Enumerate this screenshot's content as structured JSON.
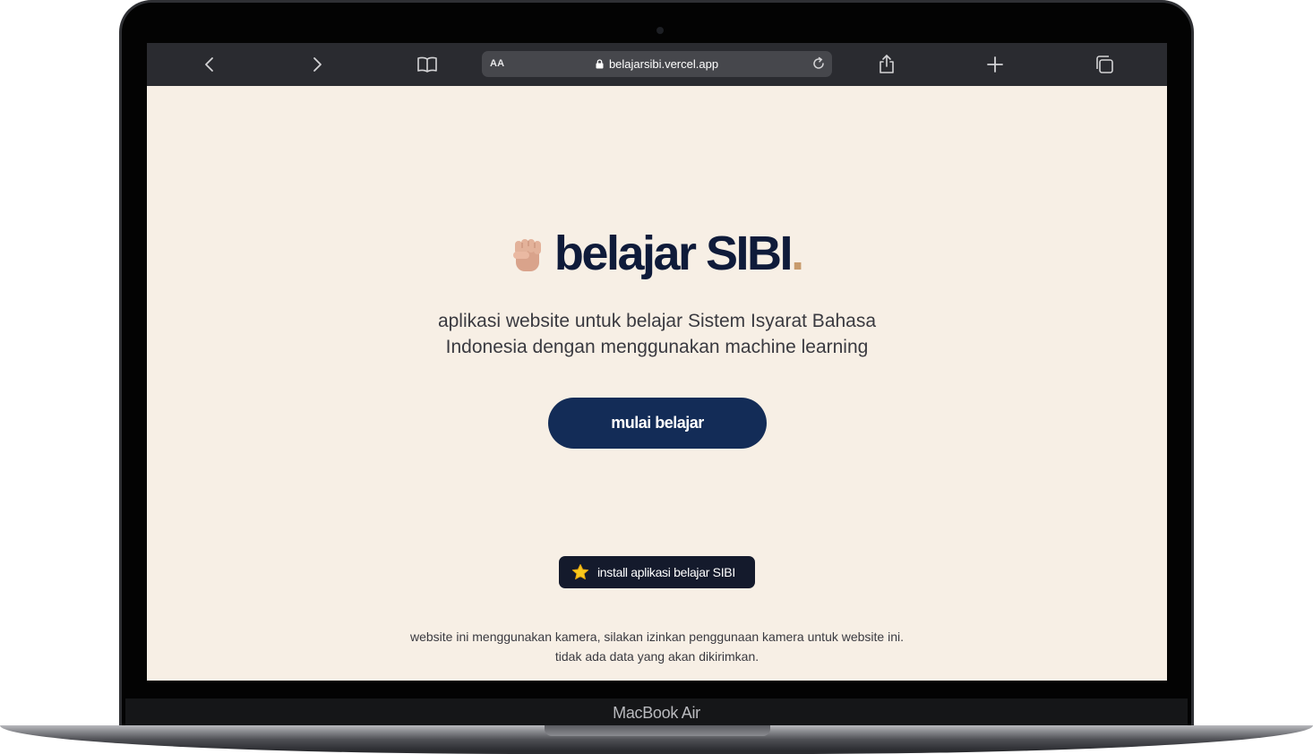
{
  "device": {
    "label": "MacBook Air"
  },
  "browser": {
    "text_size_label": "AA",
    "url": "belajarsibi.vercel.app",
    "icons": [
      "back-icon",
      "forward-icon",
      "bookmarks-icon",
      "lock-icon",
      "reload-icon",
      "share-icon",
      "new-tab-icon",
      "tabs-icon"
    ]
  },
  "page": {
    "brand_icon": "raised-fist-icon",
    "brand_title": "belajar SIBI",
    "brand_dot": ".",
    "tagline": "aplikasi website untuk belajar Sistem Isyarat Bahasa Indonesia dengan menggunakan machine learning",
    "cta_label": "mulai belajar",
    "install_icon": "star-icon",
    "install_label": "install aplikasi belajar SIBI",
    "notice": "website ini menggunakan kamera, silakan izinkan penggunaan kamera untuk website ini. tidak ada data yang akan dikirimkan."
  },
  "colors": {
    "page_background": "#f7efe5",
    "brand_navy": "#0f1b3a",
    "brand_accent": "#c89b6d",
    "cta_background": "#132c57",
    "install_background": "#141a2c",
    "browser_toolbar": "#2a2b30"
  }
}
